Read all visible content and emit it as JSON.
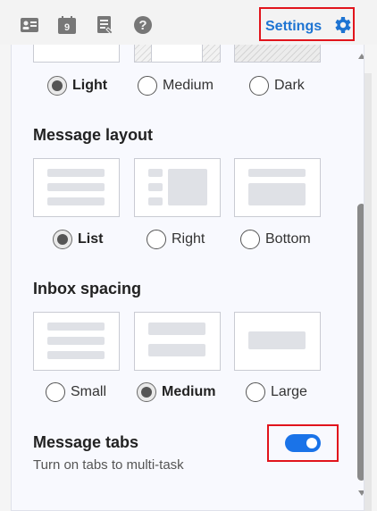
{
  "topbar": {
    "icons": [
      "contacts-card-icon",
      "calendar-icon",
      "notes-icon",
      "help-icon"
    ],
    "calendar_day": "9",
    "help_glyph": "?",
    "settings_label": "Settings"
  },
  "theme": {
    "options": [
      "Light",
      "Medium",
      "Dark"
    ],
    "selected": "Light"
  },
  "message_layout": {
    "title": "Message layout",
    "options": [
      "List",
      "Right",
      "Bottom"
    ],
    "selected": "List"
  },
  "inbox_spacing": {
    "title": "Inbox spacing",
    "options": [
      "Small",
      "Medium",
      "Large"
    ],
    "selected": "Medium"
  },
  "message_tabs": {
    "title": "Message tabs",
    "description": "Turn on tabs to multi-task",
    "enabled": true
  },
  "colors": {
    "accent": "#1e74d2",
    "toggle_on": "#1a73e8",
    "highlight_border": "#e1141c"
  }
}
